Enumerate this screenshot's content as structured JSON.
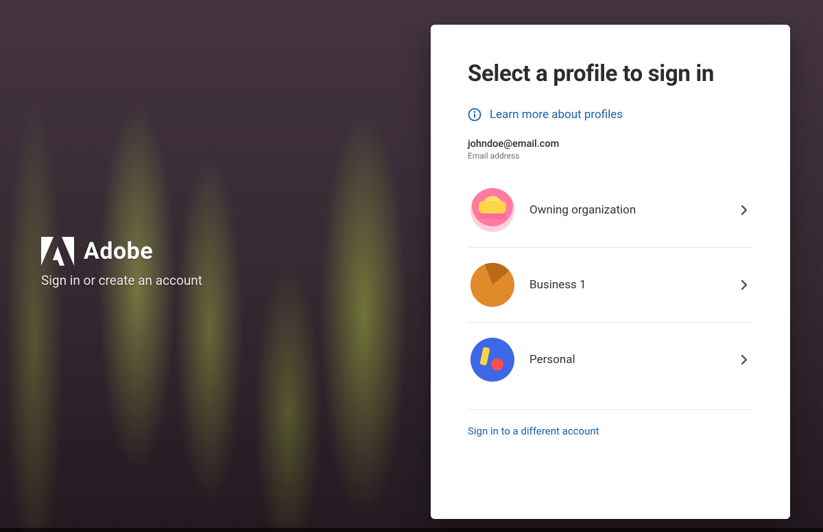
{
  "brand": {
    "name": "Adobe",
    "tagline": "Sign in or create an account"
  },
  "panel": {
    "title": "Select a profile to sign in",
    "learn_more": "Learn more about profiles",
    "email": {
      "value": "johndoe@email.com",
      "label": "Email address"
    },
    "profiles": [
      {
        "label": "Owning organization",
        "avatar": "cake-avatar"
      },
      {
        "label": "Business 1",
        "avatar": "pie-avatar"
      },
      {
        "label": "Personal",
        "avatar": "blob-avatar"
      }
    ],
    "alt_signin": "Sign in to a different account"
  },
  "colors": {
    "link": "#1b5fb0",
    "text": "#2c2c2c"
  }
}
